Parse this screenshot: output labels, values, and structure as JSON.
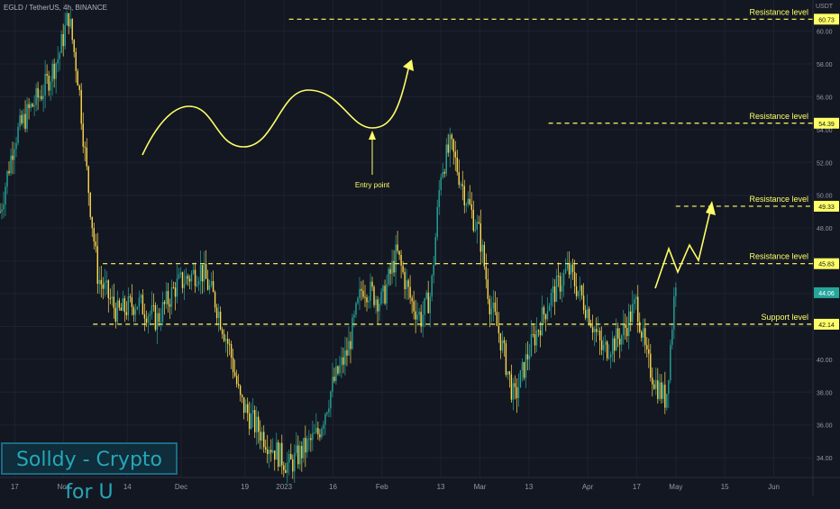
{
  "header": {
    "symbol": "EGLD / TetherUS, 4h, BINANCE",
    "currency": "USDT"
  },
  "watermark": "Solldy - Crypto for U",
  "colors": {
    "background": "#131722",
    "up_candle": "#26a69a",
    "down_candle": "#ffd84d",
    "annotation": "#ffff66",
    "axis_text": "#9598a1"
  },
  "chart_data": {
    "type": "line",
    "title": "",
    "x_ticks": [
      "17",
      "Nov",
      "14",
      "Dec",
      "19",
      "2023",
      "16",
      "Feb",
      "13",
      "Mar",
      "13",
      "Apr",
      "17",
      "May",
      "15",
      "Jun"
    ],
    "x_tick_pos": [
      0.3,
      1.3,
      2.6,
      3.7,
      5.0,
      5.8,
      6.8,
      7.8,
      9.0,
      9.8,
      10.8,
      12.0,
      13.0,
      13.8,
      14.8,
      15.8
    ],
    "y_ticks": [
      34.0,
      36.0,
      38.0,
      40.0,
      42.0,
      44.0,
      46.0,
      48.0,
      50.0,
      52.0,
      54.0,
      56.0,
      58.0,
      60.0
    ],
    "ylim": [
      32.8,
      61.9
    ],
    "price_series": {
      "x": [
        0.0,
        0.3,
        0.6,
        0.9,
        1.2,
        1.4,
        1.6,
        1.75,
        2.0,
        2.4,
        2.8,
        3.2,
        3.6,
        4.1,
        4.4,
        4.7,
        4.9,
        5.2,
        5.6,
        5.9,
        6.2,
        6.5,
        6.8,
        7.1,
        7.4,
        7.8,
        8.1,
        8.4,
        8.6,
        8.8,
        9.0,
        9.2,
        9.5,
        9.8,
        10.0,
        10.2,
        10.5,
        10.8,
        11.2,
        11.6,
        12.0,
        12.3,
        12.7,
        13.0,
        13.2,
        13.4,
        13.6,
        13.8
      ],
      "values": [
        49.0,
        53.5,
        55.2,
        56.5,
        58.5,
        61.0,
        57.0,
        52.0,
        45.0,
        42.8,
        43.5,
        42.4,
        44.5,
        45.5,
        43.5,
        40.5,
        37.5,
        36.0,
        34.5,
        33.5,
        34.5,
        35.5,
        38.5,
        40.5,
        44.5,
        43.5,
        46.5,
        43.5,
        42.5,
        44.0,
        51.5,
        53.0,
        50.0,
        47.5,
        43.5,
        41.5,
        37.5,
        40.5,
        43.5,
        45.5,
        43.0,
        40.5,
        41.5,
        43.5,
        40.0,
        38.5,
        37.5,
        45.0
      ]
    },
    "levels": [
      {
        "price": 60.73,
        "label": "Resistance level",
        "tag": "60.73"
      },
      {
        "price": 54.39,
        "label": "Resistance level",
        "tag": "54.39"
      },
      {
        "price": 49.33,
        "label": "Resistance level",
        "tag": "49.33"
      },
      {
        "price": 45.83,
        "label": "Resistance level",
        "tag": "45.83"
      },
      {
        "price": 42.14,
        "label": "Support level",
        "tag": "42.14"
      }
    ],
    "current_price": {
      "value": 44.06,
      "tag": "44.06"
    },
    "annotations": [
      {
        "type": "text",
        "text": "Entry point"
      }
    ]
  }
}
